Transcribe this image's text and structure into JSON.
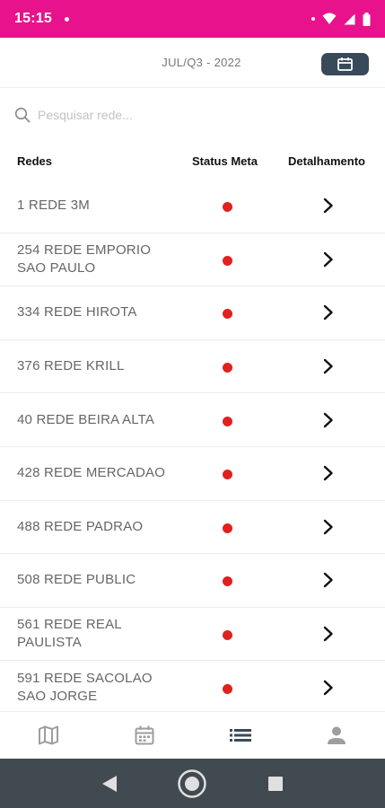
{
  "status_bar": {
    "time": "15:15"
  },
  "header": {
    "period": "JUL/Q3 - 2022"
  },
  "search": {
    "placeholder": "Pesquisar rede..."
  },
  "table": {
    "headers": {
      "redes": "Redes",
      "status": "Status Meta",
      "detail": "Detalhamento"
    },
    "rows": [
      {
        "name": "1 REDE 3M",
        "status_color": "#e0211d"
      },
      {
        "name": "254 REDE EMPORIO SAO PAULO",
        "status_color": "#e0211d"
      },
      {
        "name": "334 REDE HIROTA",
        "status_color": "#e0211d"
      },
      {
        "name": "376 REDE KRILL",
        "status_color": "#e0211d"
      },
      {
        "name": "40 REDE BEIRA ALTA",
        "status_color": "#e0211d"
      },
      {
        "name": "428 REDE MERCADAO",
        "status_color": "#e0211d"
      },
      {
        "name": "488 REDE PADRAO",
        "status_color": "#e0211d"
      },
      {
        "name": "508 REDE PUBLIC",
        "status_color": "#e0211d"
      },
      {
        "name": "561 REDE REAL PAULISTA",
        "status_color": "#e0211d"
      },
      {
        "name": "591 REDE SACOLAO SAO JORGE",
        "status_color": "#e0211d"
      }
    ]
  },
  "bottom_nav": [
    {
      "icon": "map-icon",
      "active": false
    },
    {
      "icon": "calendar-icon",
      "active": false
    },
    {
      "icon": "list-icon",
      "active": true
    },
    {
      "icon": "person-icon",
      "active": false
    }
  ],
  "colors": {
    "accent": "#e8128c",
    "nav_active": "#3a4a5a",
    "nav_inactive": "#9e9e9e",
    "status_red": "#e0211d",
    "calendar_button": "#38495a"
  }
}
